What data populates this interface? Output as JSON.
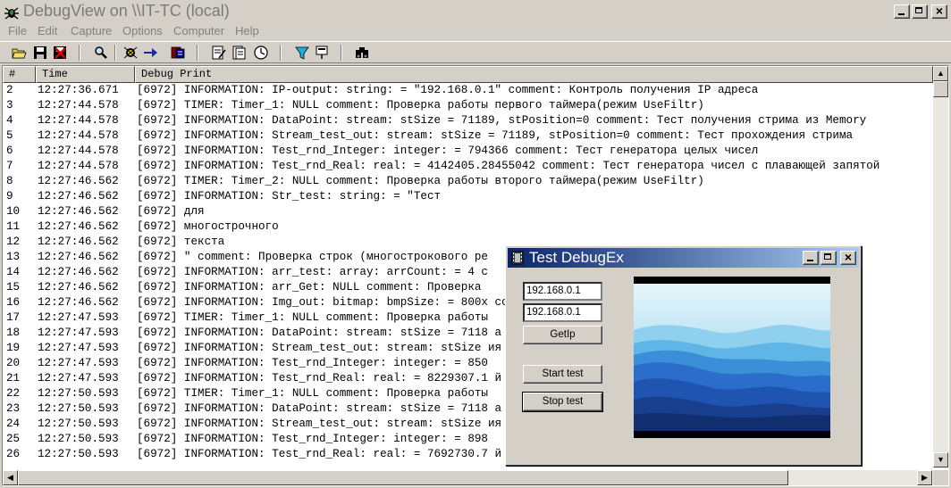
{
  "window": {
    "title": "DebugView on \\\\IT-TC (local)"
  },
  "menu": [
    "File",
    "Edit",
    "Capture",
    "Options",
    "Computer",
    "Help"
  ],
  "toolbar": {
    "icons": [
      "open-icon",
      "save-icon",
      "clear-icon",
      "find-icon",
      "capture-icon",
      "autoscroll-icon",
      "filter-icon",
      "properties-icon",
      "history-icon",
      "clock-icon",
      "highlight-icon",
      "bookmark-icon",
      "binoculars-icon"
    ]
  },
  "list": {
    "columns": [
      "#",
      "Time",
      "Debug Print"
    ],
    "rows": [
      {
        "n": "2",
        "time": "12:27:36.671",
        "msg": "[6972] INFORMATION: IP-output: string: = \"192.168.0.1\" comment: Контроль получения IP адреса"
      },
      {
        "n": "3",
        "time": "12:27:44.578",
        "msg": "[6972] TIMER: Timer_1: NULL comment: Проверка работы первого таймера(режим UseFiltr)"
      },
      {
        "n": "4",
        "time": "12:27:44.578",
        "msg": "[6972] INFORMATION: DataPoint: stream: stSize = 71189, stPosition=0 comment: Тест получения стрима из Memory"
      },
      {
        "n": "5",
        "time": "12:27:44.578",
        "msg": "[6972] INFORMATION: Stream_test_out: stream: stSize = 71189, stPosition=0 comment: Тест прохождения стрима"
      },
      {
        "n": "6",
        "time": "12:27:44.578",
        "msg": "[6972] INFORMATION: Test_rnd_Integer: integer: = 794366 comment: Тест генератора целых чисел"
      },
      {
        "n": "7",
        "time": "12:27:44.578",
        "msg": "[6972] INFORMATION: Test_rnd_Real: real: = 4142405.28455042 comment: Тест генератора чисел с плавающей запятой"
      },
      {
        "n": "8",
        "time": "12:27:46.562",
        "msg": "[6972] TIMER: Timer_2: NULL comment: Проверка работы второго таймера(режим UseFiltr)"
      },
      {
        "n": "9",
        "time": "12:27:46.562",
        "msg": "[6972] INFORMATION: Str_test: string: = \"Тест"
      },
      {
        "n": "10",
        "time": "12:27:46.562",
        "msg": "[6972] для"
      },
      {
        "n": "11",
        "time": "12:27:46.562",
        "msg": "[6972] многострочного"
      },
      {
        "n": "12",
        "time": "12:27:46.562",
        "msg": "[6972] текста"
      },
      {
        "n": "13",
        "time": "12:27:46.562",
        "msg": "[6972] \" comment: Проверка строк (многострокового ре"
      },
      {
        "n": "14",
        "time": "12:27:46.562",
        "msg": "[6972] INFORMATION: arr_test: array: arrCount: = 4 c"
      },
      {
        "n": "15",
        "time": "12:27:46.562",
        "msg": "[6972] INFORMATION: arr_Get: NULL comment: Проверка"
      },
      {
        "n": "16",
        "time": "12:27:46.562",
        "msg": "[6972] INFORMATION: Img_out: bitmap: bmpSize: = 800x                                  ссива изобр"
      },
      {
        "n": "17",
        "time": "12:27:47.593",
        "msg": "[6972] TIMER: Timer_1: NULL comment: Проверка работы"
      },
      {
        "n": "18",
        "time": "12:27:47.593",
        "msg": "[6972] INFORMATION: DataPoint: stream: stSize = 7118                                  а из Memory"
      },
      {
        "n": "19",
        "time": "12:27:47.593",
        "msg": "[6972] INFORMATION: Stream_test_out: stream: stSize                                  ия стрима"
      },
      {
        "n": "20",
        "time": "12:27:47.593",
        "msg": "[6972] INFORMATION: Test_rnd_Integer: integer: = 850"
      },
      {
        "n": "21",
        "time": "12:27:47.593",
        "msg": "[6972] INFORMATION: Test_rnd_Real: real: = 8229307.1                                  й запятой"
      },
      {
        "n": "22",
        "time": "12:27:50.593",
        "msg": "[6972] TIMER: Timer_1: NULL comment: Проверка работы"
      },
      {
        "n": "23",
        "time": "12:27:50.593",
        "msg": "[6972] INFORMATION: DataPoint: stream: stSize = 7118                                  а из Memory"
      },
      {
        "n": "24",
        "time": "12:27:50.593",
        "msg": "[6972] INFORMATION: Stream_test_out: stream: stSize                                  ия стрима"
      },
      {
        "n": "25",
        "time": "12:27:50.593",
        "msg": "[6972] INFORMATION: Test_rnd_Integer: integer: = 898"
      },
      {
        "n": "26",
        "time": "12:27:50.593",
        "msg": "[6972] INFORMATION: Test_rnd_Real: real: = 7692730.7                                  й запятой"
      }
    ]
  },
  "dialog": {
    "title": "Test DebugEx",
    "ip_field_1": "192.168.0.1",
    "ip_field_2": "192.168.0.1",
    "getip_label": "GetIp",
    "start_label": "Start test",
    "stop_label": "Stop test"
  },
  "colors": {
    "title_active_start": "#0a246a",
    "title_active_end": "#a6caf0",
    "face": "#d4d0c8"
  }
}
